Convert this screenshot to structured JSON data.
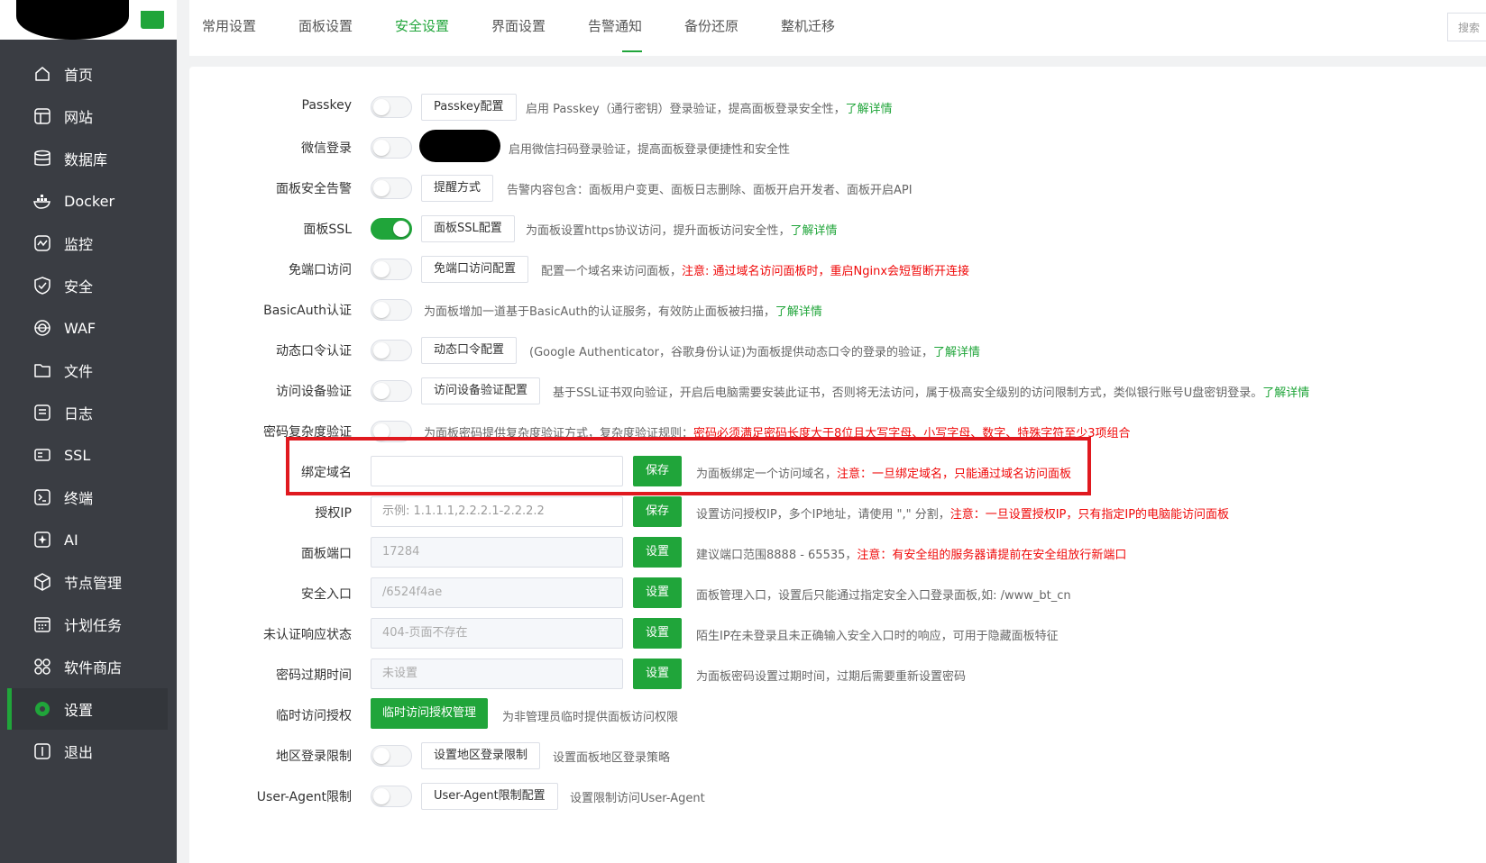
{
  "sidebar": {
    "items": [
      {
        "label": "首页",
        "icon": "home-icon"
      },
      {
        "label": "网站",
        "icon": "website-icon"
      },
      {
        "label": "数据库",
        "icon": "database-icon"
      },
      {
        "label": "Docker",
        "icon": "docker-icon"
      },
      {
        "label": "监控",
        "icon": "monitor-icon"
      },
      {
        "label": "安全",
        "icon": "shield-icon"
      },
      {
        "label": "WAF",
        "icon": "waf-icon"
      },
      {
        "label": "文件",
        "icon": "folder-icon"
      },
      {
        "label": "日志",
        "icon": "log-icon"
      },
      {
        "label": "SSL",
        "icon": "ssl-icon"
      },
      {
        "label": "终端",
        "icon": "terminal-icon"
      },
      {
        "label": "AI",
        "icon": "ai-icon"
      },
      {
        "label": "节点管理",
        "icon": "node-icon"
      },
      {
        "label": "计划任务",
        "icon": "calendar-icon"
      },
      {
        "label": "软件商店",
        "icon": "store-icon"
      },
      {
        "label": "设置",
        "icon": "settings-icon",
        "active": true
      },
      {
        "label": "退出",
        "icon": "logout-icon"
      }
    ]
  },
  "tabs": [
    "常用设置",
    "面板设置",
    "安全设置",
    "界面设置",
    "告警通知",
    "备份还原",
    "整机迁移"
  ],
  "active_tab": "安全设置",
  "search": {
    "placeholder": "搜索"
  },
  "colors": {
    "accent": "#20a53a",
    "warning": "#ef0808",
    "highlight_border": "#e0191f"
  },
  "settings": {
    "passkey": {
      "label": "Passkey",
      "button": "Passkey配置",
      "desc": "启用 Passkey（通行密钥）登录验证，提高面板登录安全性，",
      "link": "了解详情"
    },
    "wechat": {
      "label": "微信登录",
      "desc": "启用微信扫码登录验证，提高面板登录便捷性和安全性"
    },
    "alarm": {
      "label": "面板安全告警",
      "button": "提醒方式",
      "desc": "告警内容包含：面板用户变更、面板日志删除、面板开启开发者、面板开启API"
    },
    "ssl": {
      "label": "面板SSL",
      "button": "面板SSL配置",
      "desc": "为面板设置https协议访问，提升面板访问安全性，",
      "link": "了解详情"
    },
    "portless": {
      "label": "免端口访问",
      "button": "免端口访问配置",
      "desc": "配置一个域名来访问面板，",
      "warn": "注意: 通过域名访问面板时，重启Nginx会短暂断开连接"
    },
    "basicauth": {
      "label": "BasicAuth认证",
      "desc": "为面板增加一道基于BasicAuth的认证服务，有效防止面板被扫描，",
      "link": "了解详情"
    },
    "totp": {
      "label": "动态口令认证",
      "button": "动态口令配置",
      "desc": "(Google Authenticator，谷歌身份认证)为面板提供动态口令的登录的验证，",
      "link": "了解详情"
    },
    "device": {
      "label": "访问设备验证",
      "button": "访问设备验证配置",
      "desc": "基于SSL证书双向验证，开启后电脑需要安装此证书，否则将无法访问，属于极高安全级别的访问限制方式，类似银行账号U盘密钥登录。",
      "link": "了解详情"
    },
    "pwcomplex": {
      "label": "密码复杂度验证",
      "desc": "为面板密码提供复杂度验证方式，复杂度验证规则：",
      "warn": "密码必须满足密码长度大于8位且大写字母、小写字母、数字、特殊字符至少3项组合"
    },
    "domain": {
      "label": "绑定域名",
      "value": "",
      "button": "保存",
      "desc": "为面板绑定一个访问域名，",
      "warn": "注意：一旦绑定域名，只能通过域名访问面板"
    },
    "authip": {
      "label": "授权IP",
      "placeholder": "示例: 1.1.1.1,2.2.2.1-2.2.2.2",
      "button": "保存",
      "desc": "设置访问授权IP，多个IP地址，请使用 \",\" 分割，",
      "warn": "注意：一旦设置授权IP，只有指定IP的电脑能访问面板"
    },
    "port": {
      "label": "面板端口",
      "value": "17284",
      "button": "设置",
      "desc": "建议端口范围8888 - 65535，",
      "warn": "注意：有安全组的服务器请提前在安全组放行新端口"
    },
    "entry": {
      "label": "安全入口",
      "value": "/6524f4ae",
      "button": "设置",
      "desc": "面板管理入口，设置后只能通过指定安全入口登录面板,如: /www_bt_cn"
    },
    "unauth": {
      "label": "未认证响应状态",
      "value": "404-页面不存在",
      "button": "设置",
      "desc": "陌生IP在未登录且未正确输入安全入口时的响应，可用于隐藏面板特征"
    },
    "pwexpire": {
      "label": "密码过期时间",
      "value": "未设置",
      "button": "设置",
      "desc": "为面板密码设置过期时间，过期后需要重新设置密码"
    },
    "tempaccess": {
      "label": "临时访问授权",
      "button": "临时访问授权管理",
      "desc": "为非管理员临时提供面板访问权限"
    },
    "region": {
      "label": "地区登录限制",
      "button": "设置地区登录限制",
      "desc": "设置面板地区登录策略"
    },
    "useragent": {
      "label": "User-Agent限制",
      "button": "User-Agent限制配置",
      "desc": "设置限制访问User-Agent"
    }
  }
}
